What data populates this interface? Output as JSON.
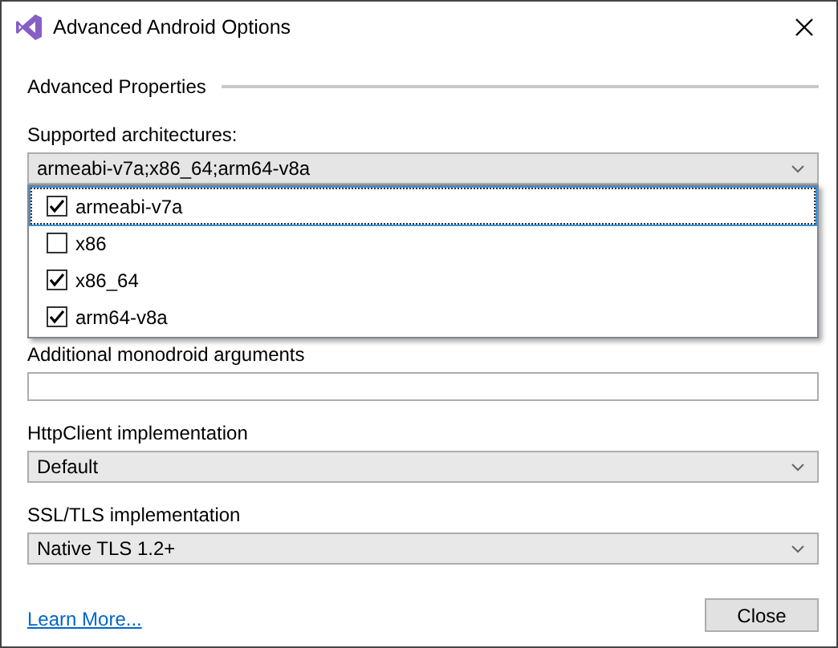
{
  "window": {
    "title": "Advanced Android Options"
  },
  "section": {
    "title": "Advanced Properties"
  },
  "architectures": {
    "label": "Supported architectures:",
    "value": "armeabi-v7a;x86_64;arm64-v8a",
    "expanded": true,
    "options": [
      {
        "label": "armeabi-v7a",
        "checked": true,
        "selected": true
      },
      {
        "label": "x86",
        "checked": false,
        "selected": false
      },
      {
        "label": "x86_64",
        "checked": true,
        "selected": false
      },
      {
        "label": "arm64-v8a",
        "checked": true,
        "selected": false
      }
    ]
  },
  "monodroid": {
    "label": "Additional monodroid arguments"
  },
  "httpclient": {
    "label": "HttpClient implementation",
    "value": "Default"
  },
  "ssl": {
    "label": "SSL/TLS implementation",
    "value": "Native TLS 1.2+"
  },
  "footer": {
    "link": "Learn More...",
    "button": "Close"
  }
}
